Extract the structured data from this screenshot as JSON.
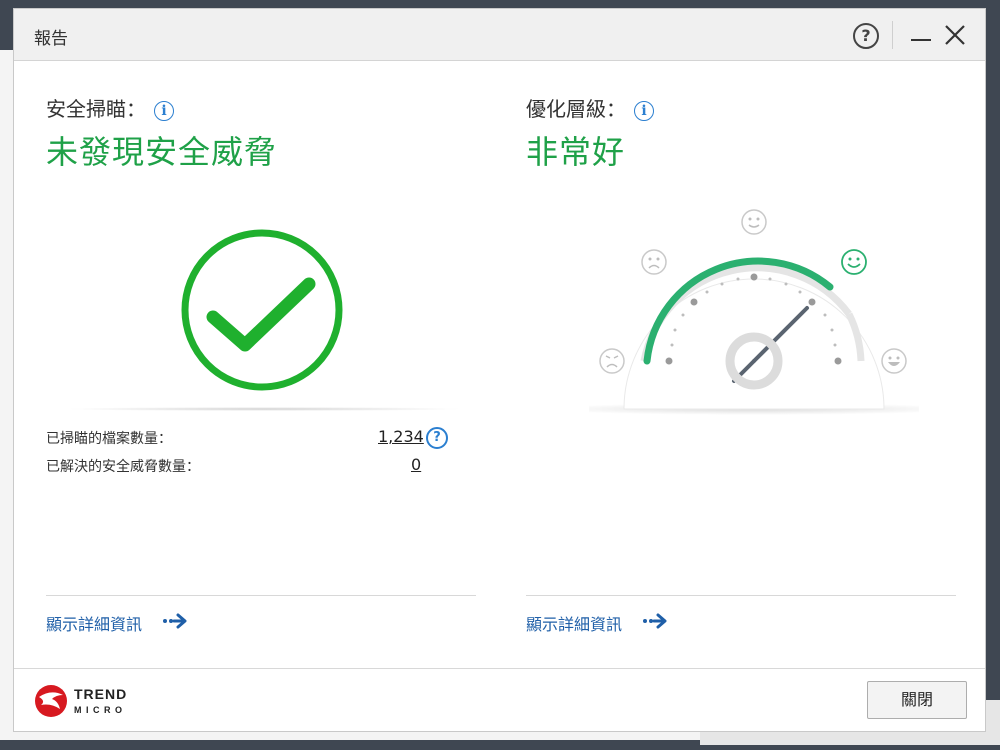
{
  "dialog": {
    "title": "報告",
    "help_glyph": "?",
    "close_glyph": "✕"
  },
  "security": {
    "label": "安全掃瞄：",
    "status": "未發現安全威脅",
    "scanned_label": "已掃瞄的檔案數量：",
    "scanned_value": "1,234",
    "resolved_label": "已解決的安全威脅數量：",
    "resolved_value": "0",
    "details_link": "顯示詳細資訊"
  },
  "optimization": {
    "label": "優化層級：",
    "status": "非常好",
    "details_link": "顯示詳細資訊"
  },
  "footer": {
    "close_button": "關閉",
    "logo_line1": "TREND",
    "logo_line2": "MICRO"
  },
  "colors": {
    "status_green": "#1fa148",
    "link_blue": "#1f5fa8",
    "gauge_green": "#2bb070",
    "brand_red": "#d71920"
  },
  "icons": {
    "info": "info-icon",
    "check": "check-circle-icon",
    "arrow": "double-arrow-right-icon",
    "faces": [
      "angry-face-icon",
      "sad-face-icon",
      "neutral-face-icon",
      "smile-face-icon",
      "happy-face-icon"
    ]
  }
}
